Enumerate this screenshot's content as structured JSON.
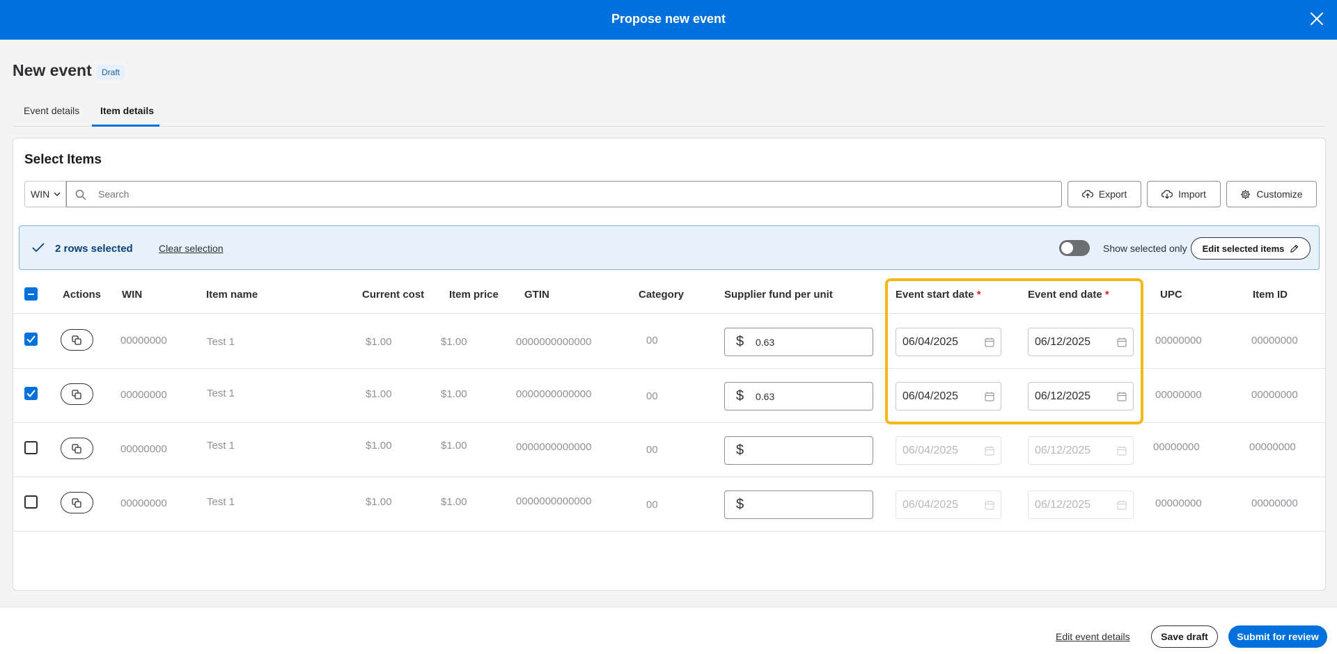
{
  "modal": {
    "title": "Propose new event",
    "close_icon": "close-icon"
  },
  "page": {
    "title": "New event",
    "status_badge": "Draft"
  },
  "tabs": [
    {
      "label": "Event details",
      "active": false
    },
    {
      "label": "Item details",
      "active": true
    }
  ],
  "section": {
    "title": "Select Items"
  },
  "search": {
    "type_value": "WIN",
    "placeholder": "Search"
  },
  "toolbar": {
    "export_label": "Export",
    "import_label": "Import",
    "customize_label": "Customize"
  },
  "selection": {
    "count_text": "2 rows selected",
    "clear_label": "Clear selection",
    "show_selected_label": "Show selected only",
    "show_selected_on": false,
    "edit_label": "Edit selected items"
  },
  "table": {
    "headers": {
      "actions": "Actions",
      "win": "WIN",
      "item_name": "Item name",
      "current_cost": "Current cost",
      "item_price": "Item price",
      "gtin": "GTIN",
      "category": "Category",
      "supplier_fund": "Supplier fund per unit",
      "event_start": "Event start date",
      "event_end": "Event end date",
      "required_marker": "*",
      "upc": "UPC",
      "item_id": "Item ID"
    },
    "currency_symbol": "$",
    "rows": [
      {
        "selected": true,
        "win": "00000000",
        "item_name": "Test 1",
        "current_cost": "$1.00",
        "item_price": "$1.00",
        "gtin": "0000000000000",
        "category": "00",
        "supplier_fund": "0.63",
        "start_date": "06/04/2025",
        "end_date": "06/12/2025",
        "upc": "00000000",
        "item_id": "00000000"
      },
      {
        "selected": true,
        "win": "00000000",
        "item_name": "Test 1",
        "current_cost": "$1.00",
        "item_price": "$1.00",
        "gtin": "0000000000000",
        "category": "00",
        "supplier_fund": "0.63",
        "start_date": "06/04/2025",
        "end_date": "06/12/2025",
        "upc": "00000000",
        "item_id": "00000000"
      },
      {
        "selected": false,
        "win": "00000000",
        "item_name": "Test 1",
        "current_cost": "$1.00",
        "item_price": "$1.00",
        "gtin": "0000000000000",
        "category": "00",
        "supplier_fund": "",
        "start_date": "06/04/2025",
        "end_date": "06/12/2025",
        "upc": "00000000",
        "item_id": "00000000"
      },
      {
        "selected": false,
        "win": "00000000",
        "item_name": "Test 1",
        "current_cost": "$1.00",
        "item_price": "$1.00",
        "gtin": "0000000000000",
        "category": "00",
        "supplier_fund": "",
        "start_date": "06/04/2025",
        "end_date": "06/12/2025",
        "upc": "00000000",
        "item_id": "00000000"
      }
    ]
  },
  "footer": {
    "edit_event_label": "Edit event details",
    "save_label": "Save draft",
    "submit_label": "Submit for review"
  },
  "colors": {
    "primary": "#0071dc",
    "highlight": "#f7b817",
    "required": "#de1c24",
    "selection_bg": "#e6f1fc"
  }
}
